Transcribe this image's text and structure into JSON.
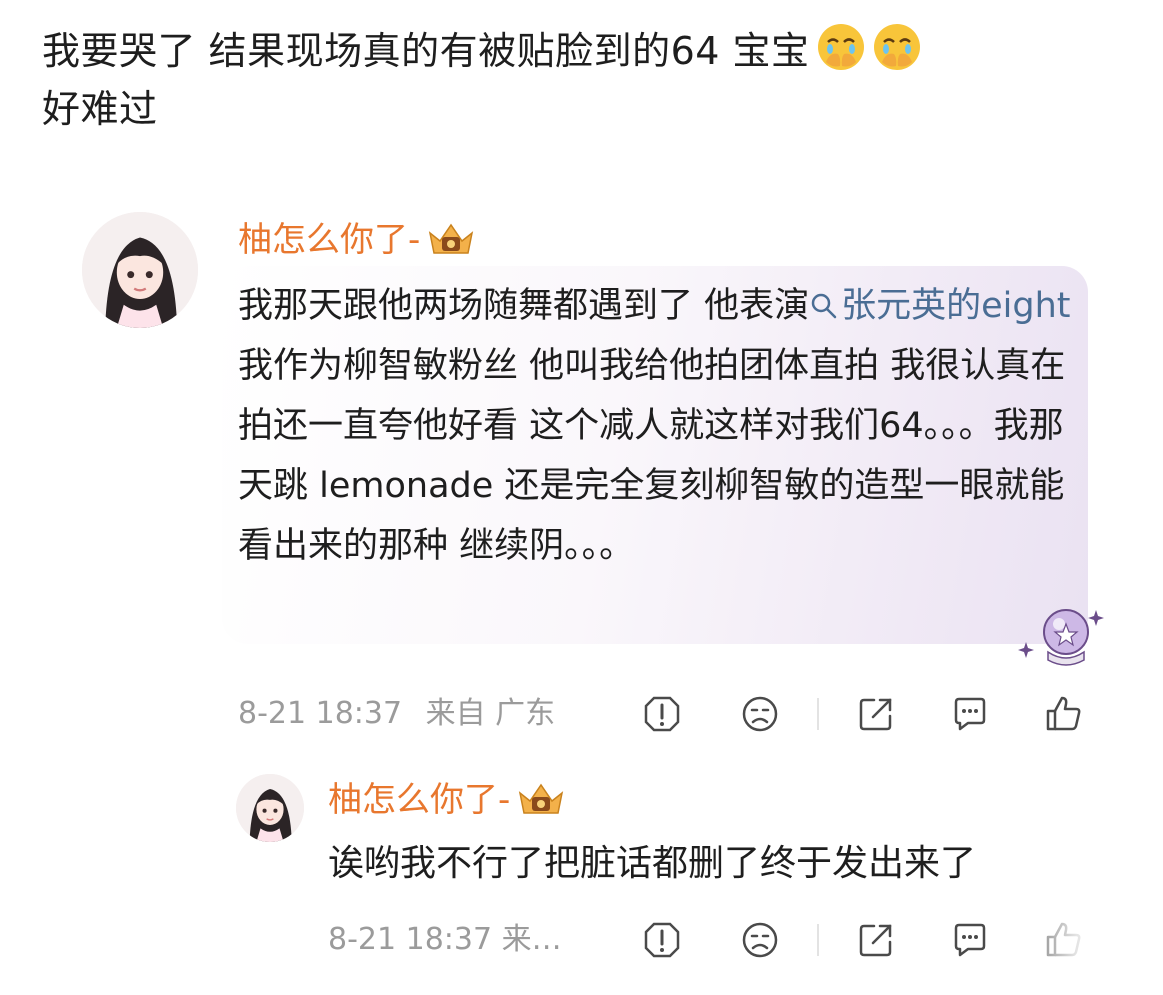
{
  "post": {
    "text": "我要哭了 结果现场真的有被贴脸到的64 宝宝",
    "text2": "好难过",
    "emoji": "crying-hands-over-mouth-emoji"
  },
  "comment": {
    "username": "柚怎么你了-",
    "text_before_link": "我那天跟他两场随舞都遇到了 他表演",
    "link_text": "张元英的eight",
    "text_after_link": " 我作为柳智敏粉丝 他叫我给他拍团体直拍 我很认真在拍还一直夸他好看 这个减人就这样对我们64。。。我那天跳 lemonade 还是完全复刻柳智敏的造型一眼就能看出来的那种 继续阴。。。",
    "time": "8-21 18:37",
    "location": "来自 广东"
  },
  "reply": {
    "username": "柚怎么你了-",
    "text": "诶哟我不行了把脏话都删了终于发出来了",
    "meta": "8-21 18:37 来…"
  },
  "colors": {
    "username": "#e8772e",
    "link": "#4a6d94",
    "meta": "#9b9b9b",
    "icon": "#4a4a4a"
  }
}
